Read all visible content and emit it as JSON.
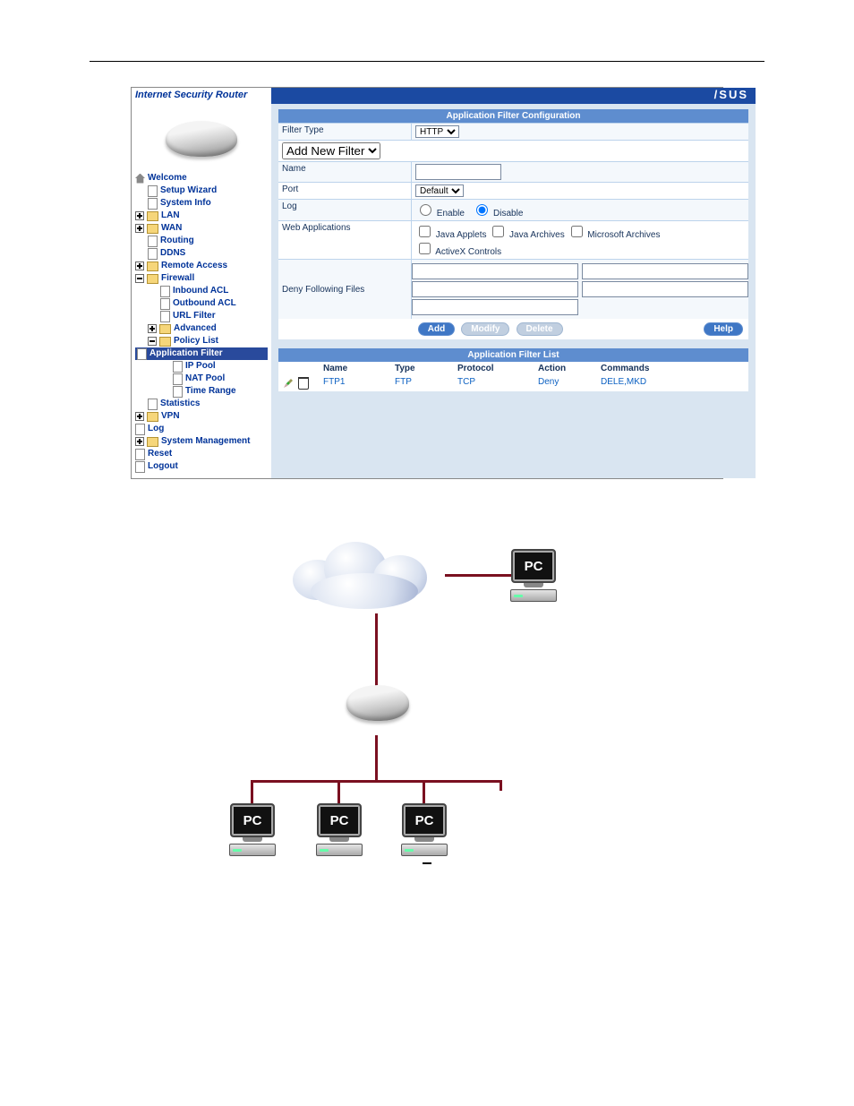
{
  "header_gap": "",
  "app": {
    "title": "Internet Security Router",
    "logo": "/SUS"
  },
  "tree": [
    {
      "level": 0,
      "icon": "home",
      "label": "Welcome",
      "bold": true
    },
    {
      "level": 1,
      "icon": "page",
      "label": "Setup Wizard"
    },
    {
      "level": 1,
      "icon": "page",
      "label": "System Info"
    },
    {
      "level": 0,
      "icon": "plus",
      "folder": true,
      "label": "LAN"
    },
    {
      "level": 0,
      "icon": "plus",
      "folder": true,
      "label": "WAN"
    },
    {
      "level": 1,
      "icon": "page",
      "label": "Routing"
    },
    {
      "level": 1,
      "icon": "page",
      "label": "DDNS"
    },
    {
      "level": 0,
      "icon": "plus",
      "folder": true,
      "label": "Remote Access"
    },
    {
      "level": 0,
      "icon": "minus",
      "folder": true,
      "open": true,
      "label": "Firewall"
    },
    {
      "level": 2,
      "icon": "page",
      "label": "Inbound ACL"
    },
    {
      "level": 2,
      "icon": "page",
      "label": "Outbound ACL"
    },
    {
      "level": 2,
      "icon": "page",
      "label": "URL Filter"
    },
    {
      "level": 1,
      "icon": "plus",
      "folder": true,
      "label": "Advanced"
    },
    {
      "level": 1,
      "icon": "minus",
      "folder": true,
      "open": true,
      "label": "Policy List"
    },
    {
      "level": 3,
      "icon": "page",
      "label": "Application Filter",
      "selected": true
    },
    {
      "level": 3,
      "icon": "page",
      "label": "IP Pool"
    },
    {
      "level": 3,
      "icon": "page",
      "label": "NAT Pool"
    },
    {
      "level": 3,
      "icon": "page",
      "label": "Time Range"
    },
    {
      "level": 1,
      "icon": "page",
      "label": "Statistics"
    },
    {
      "level": 0,
      "icon": "plus",
      "folder": true,
      "label": "VPN"
    },
    {
      "level": 0,
      "icon": "page",
      "label": "Log"
    },
    {
      "level": 0,
      "icon": "plus",
      "folder": true,
      "label": "System Management"
    },
    {
      "level": 0,
      "icon": "page",
      "label": "Reset"
    },
    {
      "level": 0,
      "icon": "page",
      "label": "Logout"
    }
  ],
  "config": {
    "title": "Application Filter Configuration",
    "rows": {
      "filter_type": {
        "label": "Filter Type",
        "value": "HTTP"
      },
      "add_new": {
        "label": "",
        "value": "Add New Filter"
      },
      "name": {
        "label": "Name",
        "value": ""
      },
      "port": {
        "label": "Port",
        "value": "Default"
      },
      "log": {
        "label": "Log",
        "enable": "Enable",
        "disable": "Disable",
        "selected": "disable"
      },
      "webapps": {
        "label": "Web Applications",
        "opts": [
          "Java Applets",
          "Java Archives",
          "Microsoft Archives",
          "ActiveX Controls"
        ]
      },
      "deny": {
        "label": "Deny Following Files"
      }
    },
    "buttons": {
      "add": "Add",
      "modify": "Modify",
      "delete": "Delete",
      "help": "Help"
    }
  },
  "list": {
    "title": "Application Filter List",
    "head": {
      "name": "Name",
      "type": "Type",
      "protocol": "Protocol",
      "action": "Action",
      "commands": "Commands"
    },
    "rows": [
      {
        "name": "FTP1",
        "type": "FTP",
        "protocol": "TCP",
        "action": "Deny",
        "commands": "DELE,MKD"
      }
    ]
  },
  "diagram": {
    "pc_label": "PC"
  }
}
